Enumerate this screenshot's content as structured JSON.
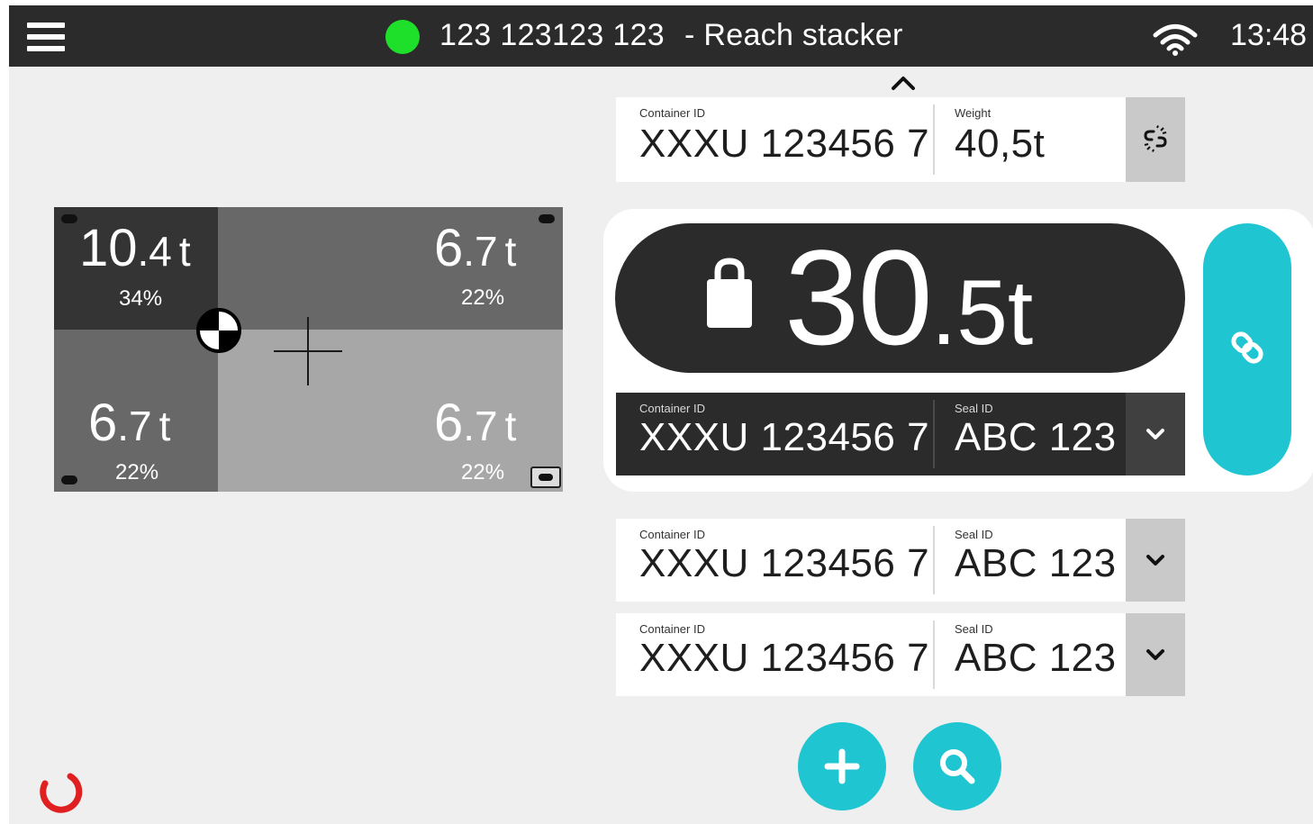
{
  "colors": {
    "topbar": "#2b2b2b",
    "background": "#efefef",
    "status_ok": "#1ee02a",
    "accent": "#1fc5d0",
    "card": "#ffffff",
    "dark_card": "#2b2b2b",
    "side_button": "#c9c9c9",
    "spinner": "#e02020",
    "quadrant_dark": "#343434",
    "quadrant_medium": "#686868",
    "quadrant_light": "#a7a7a7"
  },
  "header": {
    "menu_icon": "hamburger-menu-icon",
    "status_icon": "green-status-dot",
    "vehicle_id": "123 123123 123",
    "vehicle_type": "- Reach stacker",
    "wifi_icon": "wifi-icon",
    "time": "13:48"
  },
  "load_diagram": {
    "unit": "t",
    "quadrants": [
      {
        "position": "top-left",
        "whole": "10",
        "decimal": ".4",
        "percent": "34%",
        "shade": "dark"
      },
      {
        "position": "top-right",
        "whole": "6",
        "decimal": ".7",
        "percent": "22%",
        "shade": "medium"
      },
      {
        "position": "bottom-left",
        "whole": "6",
        "decimal": ".7",
        "percent": "22%",
        "shade": "medium"
      },
      {
        "position": "bottom-right",
        "whole": "6",
        "decimal": ".7",
        "percent": "22%",
        "shade": "light"
      }
    ],
    "center_of_gravity_icon": "center-of-gravity-icon",
    "center_marker_icon": "crosshair-icon"
  },
  "pending_container": {
    "collapse_icon": "chevron-up-icon",
    "container_label": "Container ID",
    "container_id": "XXXU 123456 7",
    "weight_label": "Weight",
    "weight": "40,5t",
    "action_icon": "broken-link-icon"
  },
  "attached": {
    "lock_icon": "weight-lock-icon",
    "total_weight_whole": "30",
    "total_weight_decimal": ".5t",
    "container_label": "Container ID",
    "container_id": "XXXU 123456 7",
    "seal_label": "Seal ID",
    "seal_id": "ABC 123",
    "expand_icon": "chevron-down-icon",
    "link_icon": "link-icon"
  },
  "queue": [
    {
      "container_label": "Container ID",
      "container_id": "XXXU 123456 7",
      "seal_label": "Seal ID",
      "seal_id": "ABC 123",
      "expand_icon": "chevron-down-icon"
    },
    {
      "container_label": "Container ID",
      "container_id": "XXXU 123456 7",
      "seal_label": "Seal ID",
      "seal_id": "ABC 123",
      "expand_icon": "chevron-down-icon"
    }
  ],
  "actions": {
    "add_icon": "plus-icon",
    "search_icon": "search-icon"
  },
  "status_indicator_icon": "loading-spinner-icon"
}
